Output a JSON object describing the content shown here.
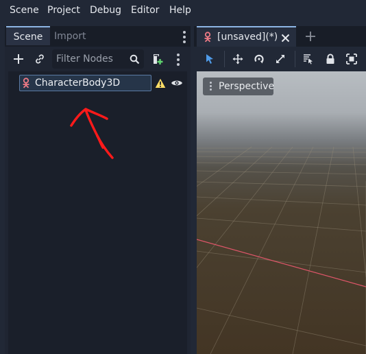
{
  "menu": {
    "items": [
      "Scene",
      "Project",
      "Debug",
      "Editor",
      "Help"
    ]
  },
  "scene_dock": {
    "tabs": {
      "scene": "Scene",
      "import": "Import"
    },
    "filter_placeholder": "Filter Nodes",
    "tree": {
      "root_node": {
        "label": "CharacterBody3D",
        "icon": "character-body-3d-icon",
        "warning": true,
        "visible": true
      }
    }
  },
  "main": {
    "scene_tab": {
      "label": "[unsaved](*)"
    },
    "viewport": {
      "view_label": "Perspective"
    }
  },
  "annotation": {
    "type": "hand-drawn red arrow pointing up at the node",
    "color": "#ff1a1a"
  },
  "colors": {
    "accent": "#8eb6e5",
    "select_tool": "#4f9be8",
    "x_axis": "#e0566a",
    "node_icon": "#f07b86",
    "warning": "#ffdd65"
  }
}
